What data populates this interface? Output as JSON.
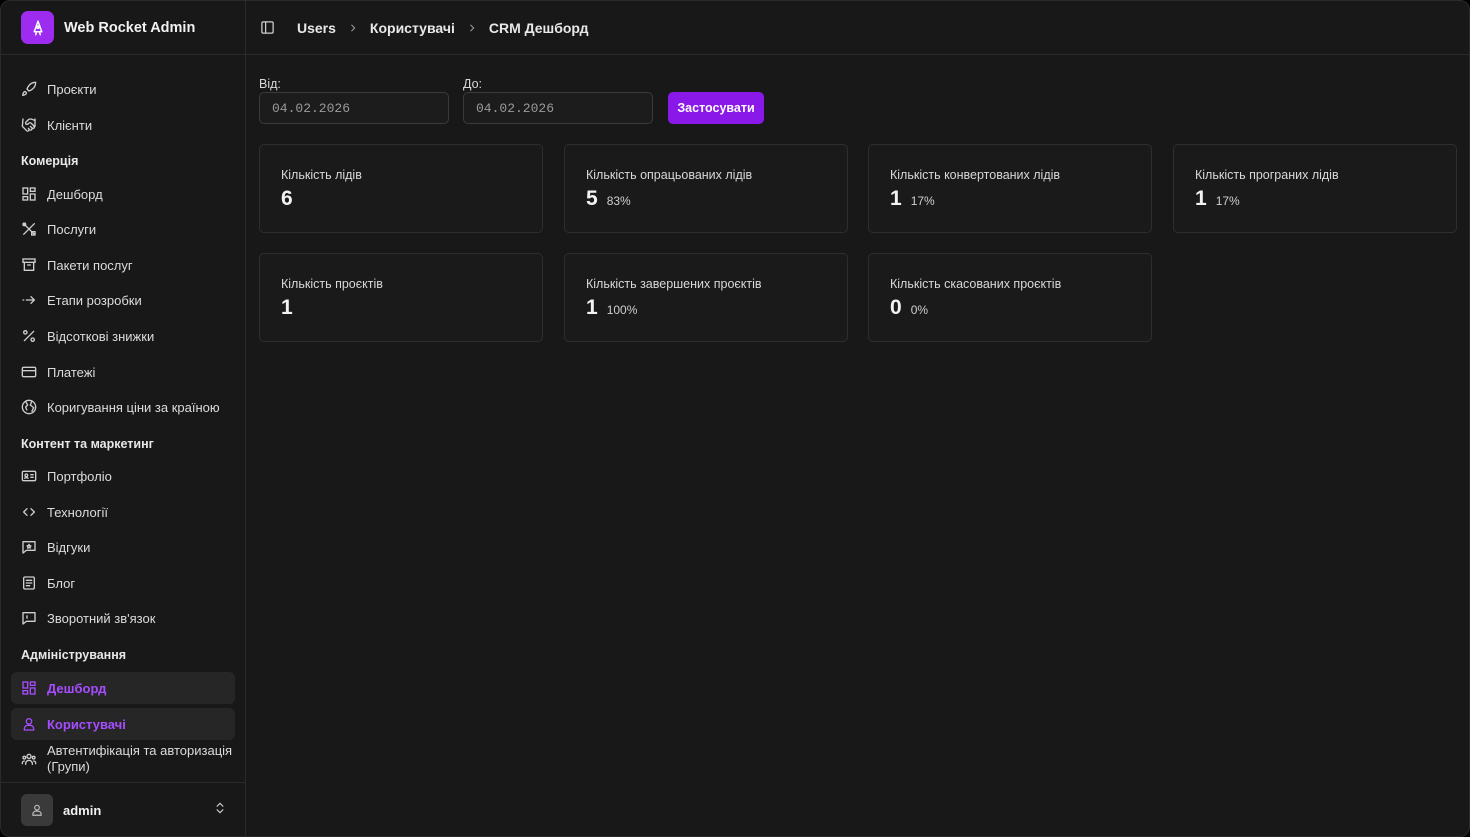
{
  "brand": {
    "name": "Web Rocket Admin",
    "icon": "rocket-icon",
    "color": "#9d2bf0"
  },
  "sidebar": {
    "items_top": [
      {
        "label": "Проєкти",
        "icon": "rocket-icon"
      },
      {
        "label": "Клієнти",
        "icon": "handshake-icon"
      }
    ],
    "sections": [
      {
        "label": "Комерція",
        "items": [
          {
            "label": "Дешборд",
            "icon": "dashboard-icon"
          },
          {
            "label": "Послуги",
            "icon": "tools-icon"
          },
          {
            "label": "Пакети послуг",
            "icon": "archive-icon"
          },
          {
            "label": "Етапи розробки",
            "icon": "arrow-right-icon"
          },
          {
            "label": "Відсоткові знижки",
            "icon": "percent-icon"
          },
          {
            "label": "Платежі",
            "icon": "credit-card-icon"
          },
          {
            "label": "Коригування ціни за країною",
            "icon": "globe-icon"
          }
        ]
      },
      {
        "label": "Контент та маркетинг",
        "items": [
          {
            "label": "Портфоліо",
            "icon": "portfolio-icon"
          },
          {
            "label": "Технології",
            "icon": "code-icon"
          },
          {
            "label": "Відгуки",
            "icon": "review-icon"
          },
          {
            "label": "Блог",
            "icon": "document-icon"
          },
          {
            "label": "Зворотний зв'язок",
            "icon": "message-icon"
          }
        ]
      },
      {
        "label": "Адміністрування",
        "items": [
          {
            "label": "Дешборд",
            "icon": "dashboard-icon",
            "active": true
          },
          {
            "label": "Користувачі",
            "icon": "user-icon",
            "active": true
          },
          {
            "label": "Автентифікація та авторизація (Групи)",
            "icon": "group-icon"
          }
        ]
      }
    ],
    "user": {
      "name": "admin",
      "icon": "user-icon"
    }
  },
  "header": {
    "toggle_icon": "sidebar-toggle-icon",
    "breadcrumbs": [
      "Users",
      "Користувачі",
      "CRM Дешборд"
    ]
  },
  "filters": {
    "from_label": "Від:",
    "from_value": "04.02.2026",
    "to_label": "До:",
    "to_value": "04.02.2026",
    "apply_label": "Застосувати"
  },
  "stats": [
    {
      "title": "Кількість лідів",
      "value": "6",
      "percent": ""
    },
    {
      "title": "Кількість опрацьованих лідів",
      "value": "5",
      "percent": "83%"
    },
    {
      "title": "Кількість конвертованих лідів",
      "value": "1",
      "percent": "17%"
    },
    {
      "title": "Кількість програних лідів",
      "value": "1",
      "percent": "17%"
    },
    {
      "title": "Кількість проєктів",
      "value": "1",
      "percent": ""
    },
    {
      "title": "Кількість завершених проєктів",
      "value": "1",
      "percent": "100%"
    },
    {
      "title": "Кількість скасованих проєктів",
      "value": "0",
      "percent": "0%"
    }
  ],
  "colors": {
    "accent": "#8a18e8",
    "active_text": "#a64dff",
    "background": "#181818"
  }
}
